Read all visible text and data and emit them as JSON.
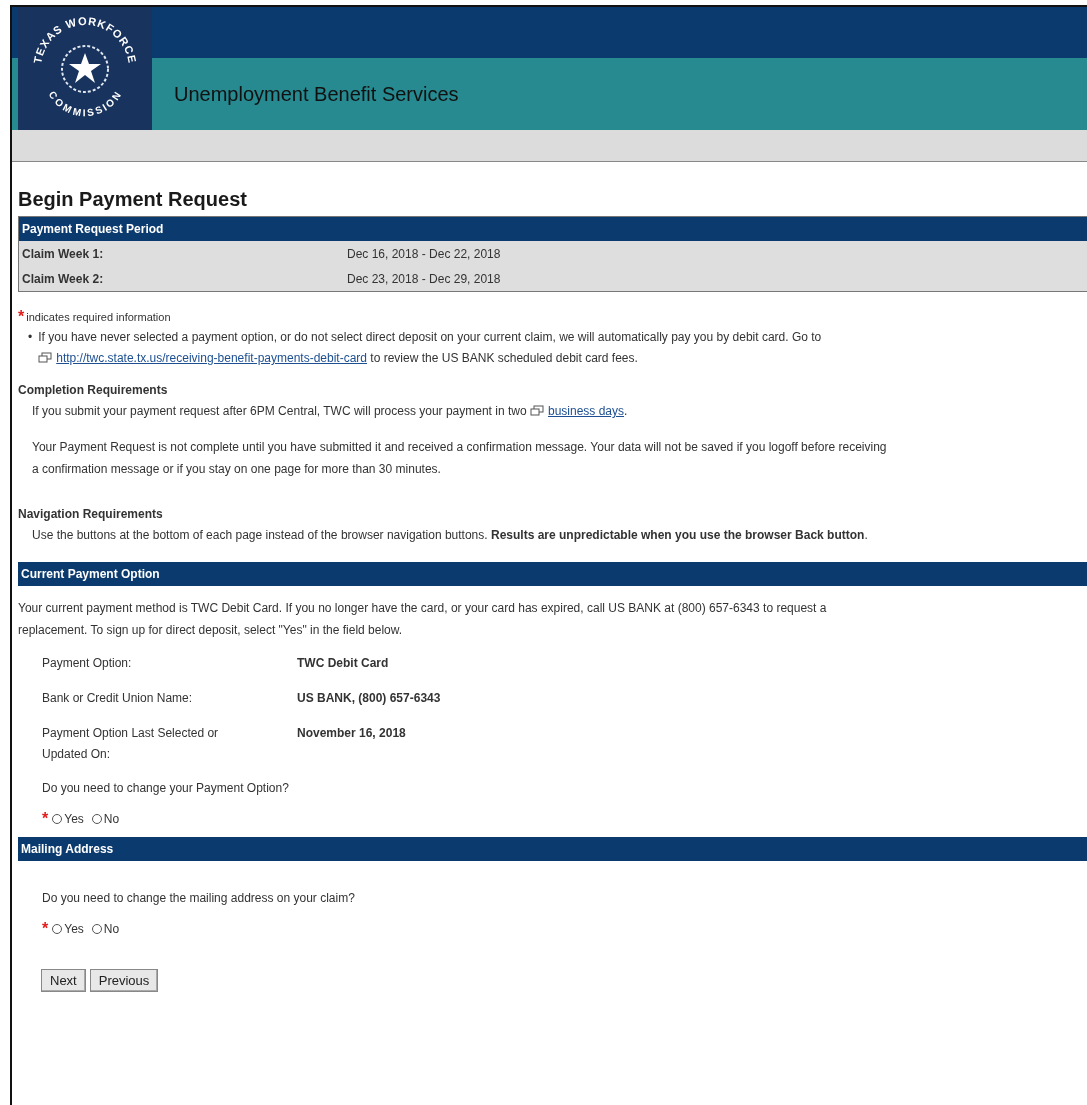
{
  "header": {
    "logo_top": "TEXAS WORKFORCE",
    "logo_bottom": "COMMISSION",
    "title": "Unemployment Benefit Services"
  },
  "page_title": "Begin Payment Request",
  "period_table": {
    "heading": "Payment Request Period",
    "rows": [
      {
        "label": "Claim Week 1:",
        "value": "Dec 16, 2018 - Dec 22, 2018"
      },
      {
        "label": "Claim Week 2:",
        "value": "Dec 23, 2018 - Dec 29, 2018"
      }
    ]
  },
  "required_note": {
    "mark": "*",
    "text": "indicates required information"
  },
  "bullet": {
    "marker": "•",
    "text": "If you have never selected a payment option, or do not select direct deposit on your current claim, we will automatically pay you by debit card. Go to",
    "link": "http://twc.state.tx.us/receiving-benefit-payments-debit-card",
    "text_after": "to review the US BANK scheduled debit card fees."
  },
  "completion": {
    "heading": "Completion Requirements",
    "text": "If you submit your payment request after 6PM Central, TWC will process your payment in two",
    "link": "business days",
    "text_end": ".",
    "note_lines": [
      "Your Payment Request is not complete until you have submitted it and received a confirmation message. Your data will not be saved if you logoff before receiving",
      "a confirmation message or if you stay on one page for more than 30 minutes."
    ]
  },
  "navigation": {
    "heading": "Navigation Requirements",
    "text": "Use the buttons at the bottom of each page instead of the browser navigation buttons. **Results are unpredictable when you use the browser Back button**."
  },
  "current_payment": {
    "heading": "Current Payment Option",
    "intro_lines": [
      "Your current payment method is TWC Debit Card. If you no longer have the card, or your card has expired, call US BANK at (800) 657-6343 to request a",
      "replacement. To sign up for direct deposit, select \"Yes\" in the field below."
    ],
    "fields": [
      {
        "label": "Payment Option:",
        "value": "TWC Debit Card"
      },
      {
        "label": "Bank or Credit Union Name:",
        "value": "US BANK, (800) 657-6343"
      },
      {
        "label": "Payment Option Last Selected or Updated On:",
        "value": "November 16, 2018"
      }
    ],
    "question": "Do you need to change your Payment Option?",
    "mark": "*",
    "options": [
      {
        "label": "Yes",
        "selected": false
      },
      {
        "label": "No",
        "selected": false
      }
    ]
  },
  "mailing": {
    "heading": "Mailing Address",
    "question": "Do you need to change the mailing address on your claim?",
    "mark": "*",
    "options": [
      {
        "label": "Yes",
        "selected": false
      },
      {
        "label": "No",
        "selected": false
      }
    ]
  },
  "buttons": [
    "Next",
    "Previous"
  ]
}
